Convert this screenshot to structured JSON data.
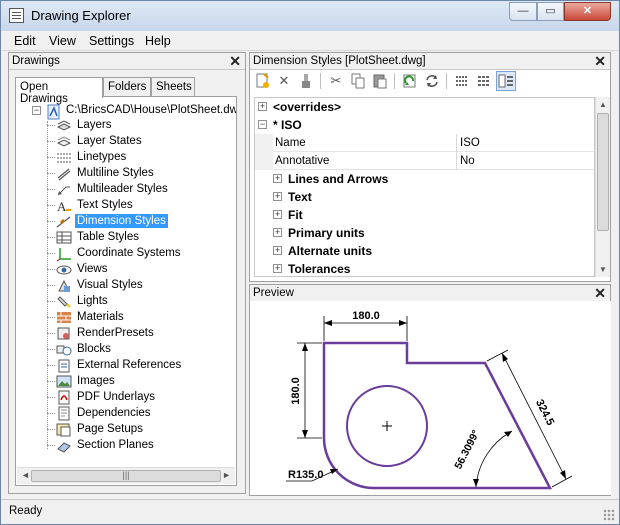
{
  "window": {
    "title": "Drawing Explorer"
  },
  "menu": [
    "Edit",
    "View",
    "Settings",
    "Help"
  ],
  "left_pane": {
    "title": "Drawings",
    "tabs": [
      "Open Drawings",
      "Folders",
      "Sheets"
    ],
    "active_tab": "Open Drawings",
    "root": "C:\\BricsCAD\\House\\PlotSheet.dwg",
    "items": [
      {
        "label": "Layers",
        "icon": "layers-icon"
      },
      {
        "label": "Layer States",
        "icon": "layer-states-icon"
      },
      {
        "label": "Linetypes",
        "icon": "linetypes-icon"
      },
      {
        "label": "Multiline Styles",
        "icon": "multiline-styles-icon"
      },
      {
        "label": "Multileader Styles",
        "icon": "multileader-styles-icon"
      },
      {
        "label": "Text Styles",
        "icon": "text-styles-icon"
      },
      {
        "label": "Dimension Styles",
        "icon": "dimension-styles-icon"
      },
      {
        "label": "Table Styles",
        "icon": "table-styles-icon"
      },
      {
        "label": "Coordinate Systems",
        "icon": "coordinate-systems-icon"
      },
      {
        "label": "Views",
        "icon": "views-icon"
      },
      {
        "label": "Visual Styles",
        "icon": "visual-styles-icon"
      },
      {
        "label": "Lights",
        "icon": "lights-icon"
      },
      {
        "label": "Materials",
        "icon": "materials-icon"
      },
      {
        "label": "RenderPresets",
        "icon": "render-presets-icon"
      },
      {
        "label": "Blocks",
        "icon": "blocks-icon"
      },
      {
        "label": "External References",
        "icon": "external-references-icon"
      },
      {
        "label": "Images",
        "icon": "images-icon"
      },
      {
        "label": "PDF Underlays",
        "icon": "pdf-underlays-icon"
      },
      {
        "label": "Dependencies",
        "icon": "dependencies-icon"
      },
      {
        "label": "Page Setups",
        "icon": "page-setups-icon"
      },
      {
        "label": "Section Planes",
        "icon": "section-planes-icon"
      }
    ],
    "selected": "Dimension Styles"
  },
  "right_pane": {
    "title": "Dimension Styles [PlotSheet.dwg]",
    "groups_top": [
      {
        "label": "<overrides>",
        "expanded": false
      },
      {
        "label": "* ISO",
        "expanded": true
      }
    ],
    "properties": [
      {
        "name": "Name",
        "value": "ISO"
      },
      {
        "name": "Annotative",
        "value": "No"
      }
    ],
    "subgroups": [
      "Lines and Arrows",
      "Text",
      "Fit",
      "Primary units",
      "Alternate units",
      "Tolerances"
    ]
  },
  "preview": {
    "title": "Preview",
    "dim_top": "180.0",
    "dim_left": "180.0",
    "dim_diag": "324.5",
    "dim_angle": "56.3099°",
    "dim_radius": "R135.0"
  },
  "status": {
    "text": "Ready"
  }
}
